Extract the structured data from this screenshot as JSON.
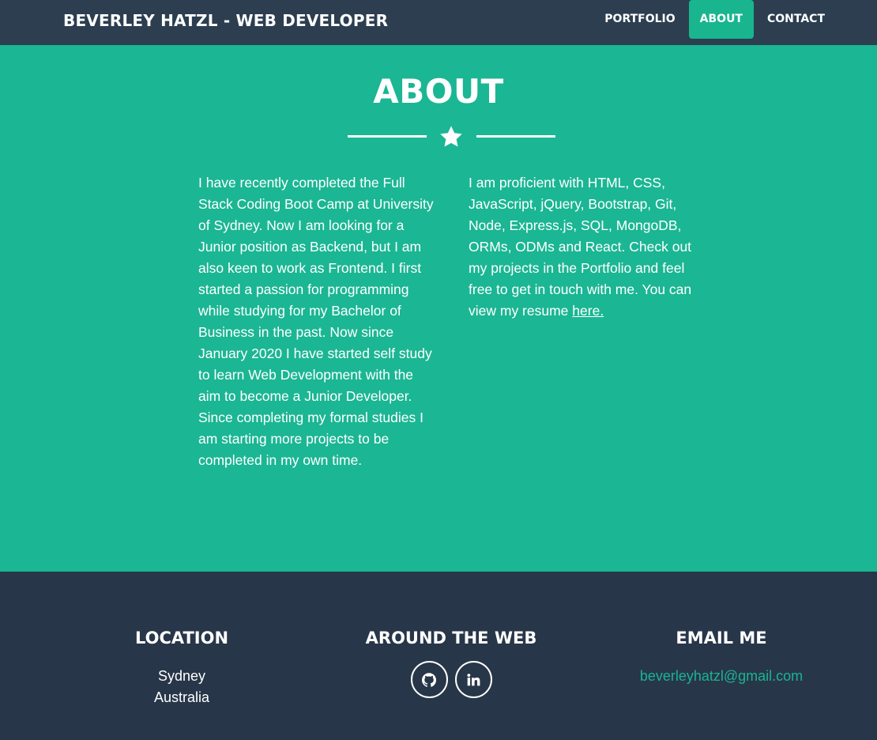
{
  "nav": {
    "brand": "BEVERLEY HATZL - WEB DEVELOPER",
    "items": [
      {
        "label": "PORTFOLIO",
        "active": false
      },
      {
        "label": "ABOUT",
        "active": true
      },
      {
        "label": "CONTACT",
        "active": false
      }
    ]
  },
  "about": {
    "title": "ABOUT",
    "divider_icon": "star-icon",
    "left_text": "I have recently completed the Full Stack Coding Boot Camp at University of Sydney. Now I am looking for a Junior position as Backend, but I am also keen to work as Frontend. I first started a passion for programming while studying for my Bachelor of Business in the past. Now since January 2020 I have started self study to learn Web Development with the aim to become a Junior Developer. Since completing my formal studies I am starting more projects to be completed in my own time.",
    "right_text": "I am proficient with HTML, CSS, JavaScript, jQuery, Bootstrap, Git, Node, Express.js, SQL, MongoDB, ORMs, ODMs and React. Check out my projects in the Portfolio and feel free to get in touch with me. You can view my resume",
    "resume_link": "here."
  },
  "footer": {
    "location": {
      "heading": "LOCATION",
      "line1": "Sydney",
      "line2": "Australia"
    },
    "web": {
      "heading": "AROUND THE WEB",
      "icons": [
        "github-icon",
        "linkedin-icon"
      ]
    },
    "email": {
      "heading": "EMAIL ME",
      "address": "beverleyhatzl@gmail.com"
    }
  },
  "colors": {
    "navy": "#2c3e50",
    "teal": "#1ab394",
    "white": "#ffffff"
  }
}
